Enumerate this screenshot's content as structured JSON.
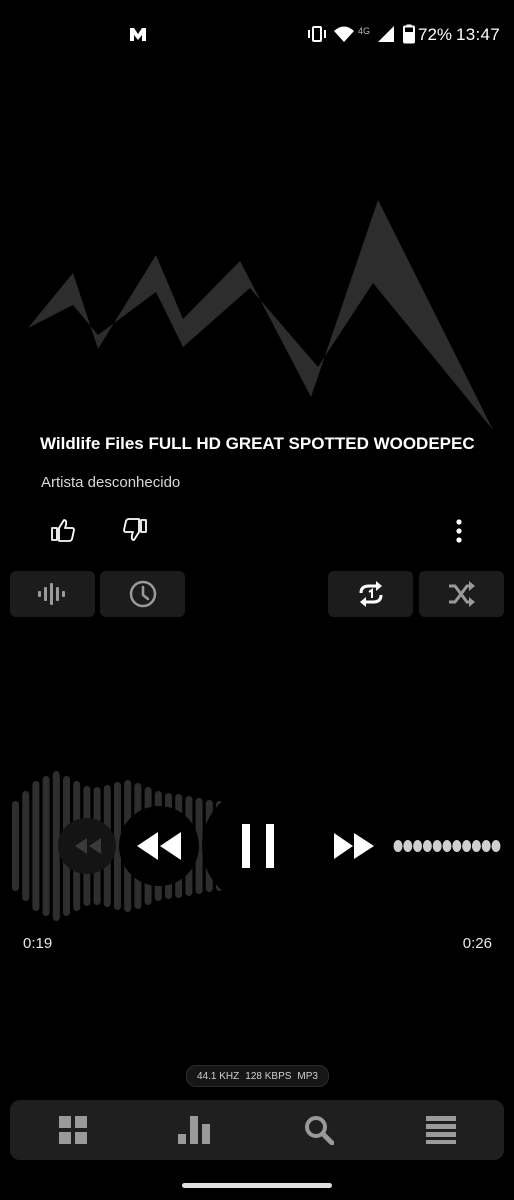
{
  "status_bar": {
    "battery": "72%",
    "time": "13:47",
    "network": "4G"
  },
  "track": {
    "title": "Wildlife Files FULL HD GREAT SPOTTED WOODEPEC",
    "artist": "Artista desconhecido"
  },
  "playback": {
    "elapsed": "0:19",
    "total": "0:26"
  },
  "audio_info": {
    "sample_rate": "44.1 KHZ",
    "bitrate": "128 KBPS",
    "format": "MP3"
  },
  "colors": {
    "background": "#000000",
    "chip": "#1c1c1c",
    "nav": "#1f1f1f",
    "icon": "#9a9a9a"
  },
  "icons": [
    "app-logo-icon",
    "vibrate-icon",
    "wifi-icon",
    "signal-icon",
    "battery-icon",
    "thumbs-up-icon",
    "thumbs-down-icon",
    "more-vert-icon",
    "equalizer-icon",
    "history-icon",
    "repeat-one-icon",
    "shuffle-icon",
    "rewind-icon",
    "pause-icon",
    "fast-forward-icon",
    "grid-icon",
    "bar-chart-icon",
    "search-icon",
    "menu-icon"
  ]
}
